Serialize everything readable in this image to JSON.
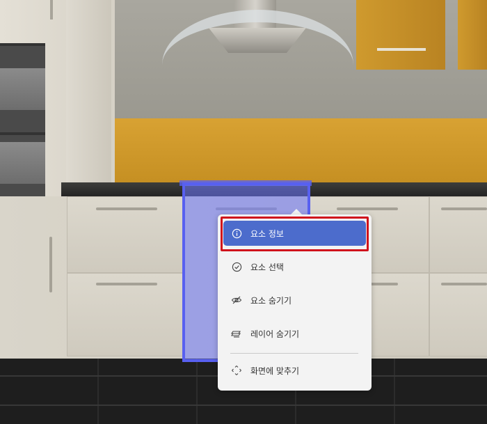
{
  "context_menu": {
    "items": [
      {
        "label": "요소 정보",
        "icon": "info-icon",
        "active": true
      },
      {
        "label": "요소 선택",
        "icon": "check-circle-icon",
        "active": false
      },
      {
        "label": "요소 숨기기",
        "icon": "eye-off-icon",
        "active": false
      },
      {
        "label": "레이어 숨기기",
        "icon": "layers-icon",
        "active": false
      },
      {
        "label": "화면에 맞추기",
        "icon": "fit-screen-icon",
        "active": false
      }
    ]
  },
  "colors": {
    "menu_active": "#4c6ccc",
    "selection": "#5860f0",
    "highlight": "#d0121b"
  }
}
